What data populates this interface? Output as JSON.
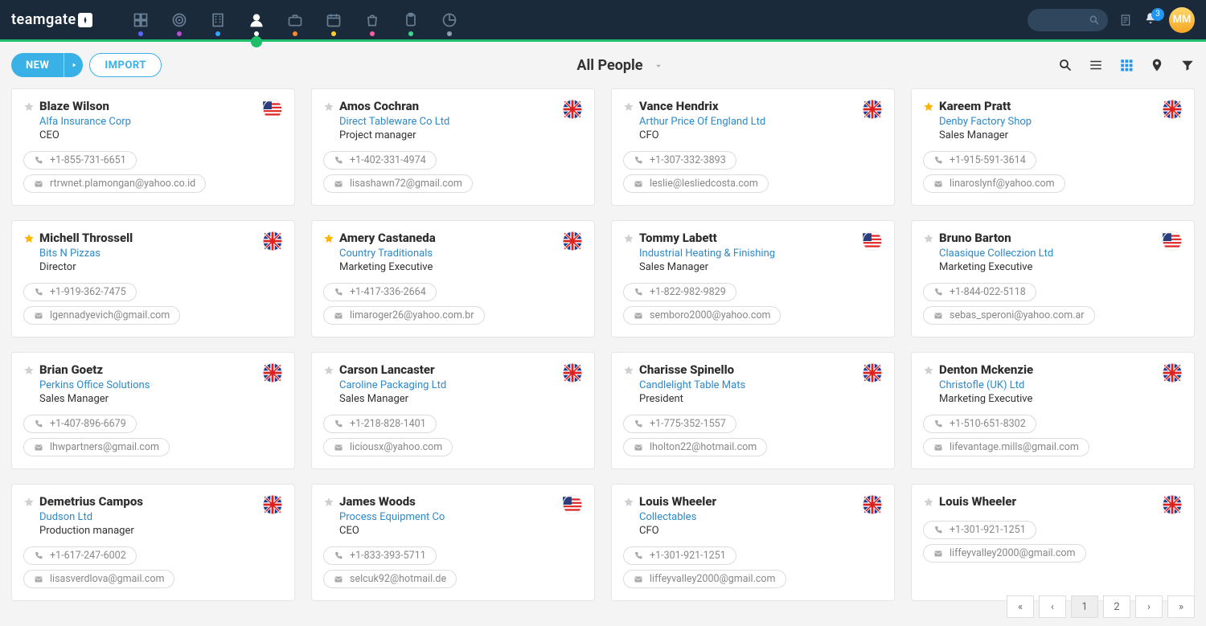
{
  "brand": "teamgate",
  "nav_dots": [
    "#5a66ff",
    "#b94fd8",
    "#2ea6ff",
    "#fff",
    "#ff8a30",
    "#ffcc33",
    "#ff5da1",
    "#39d98a",
    "#8ea0b5"
  ],
  "active_nav_index": 3,
  "notification_count": "3",
  "user_initials": "MM",
  "toolbar": {
    "new": "NEW",
    "import": "IMPORT"
  },
  "page_title": "All People",
  "people": [
    {
      "star": false,
      "name": "Blaze Wilson",
      "company": "Alfa Insurance Corp",
      "role": "CEO",
      "phone": "+1-855-731-6651",
      "email": "rtrwnet.plamongan@yahoo.co.id",
      "flag": "us"
    },
    {
      "star": false,
      "name": "Amos Cochran",
      "company": "Direct Tableware Co Ltd",
      "role": "Project manager",
      "phone": "+1-402-331-4974",
      "email": "lisashawn72@gmail.com",
      "flag": "uk"
    },
    {
      "star": false,
      "name": "Vance Hendrix",
      "company": "Arthur Price Of England Ltd",
      "role": "CFO",
      "phone": "+1-307-332-3893",
      "email": "leslie@lesliedcosta.com",
      "flag": "uk"
    },
    {
      "star": true,
      "name": "Kareem Pratt",
      "company": "Denby Factory Shop",
      "role": "Sales Manager",
      "phone": "+1-915-591-3614",
      "email": "linaroslynf@yahoo.com",
      "flag": "uk"
    },
    {
      "star": true,
      "name": "Michell Throssell",
      "company": "Bits N Pizzas",
      "role": "Director",
      "phone": "+1-919-362-7475",
      "email": "lgennadyevich@gmail.com",
      "flag": "uk"
    },
    {
      "star": true,
      "name": "Amery Castaneda",
      "company": "Country Traditionals",
      "role": "Marketing Executive",
      "phone": "+1-417-336-2664",
      "email": "limaroger26@yahoo.com.br",
      "flag": "uk"
    },
    {
      "star": false,
      "name": "Tommy Labett",
      "company": "Industrial Heating & Finishing",
      "role": "Sales Manager",
      "phone": "+1-822-982-9829",
      "email": "semboro2000@yahoo.com",
      "flag": "us"
    },
    {
      "star": false,
      "name": "Bruno Barton",
      "company": "Claasique Colleczion Ltd",
      "role": "Marketing Executive",
      "phone": "+1-844-022-5118",
      "email": "sebas_speroni@yahoo.com.ar",
      "flag": "us"
    },
    {
      "star": false,
      "name": "Brian Goetz",
      "company": "Perkins Office Solutions",
      "role": "Sales Manager",
      "phone": "+1-407-896-6679",
      "email": "lhwpartners@gmail.com",
      "flag": "uk"
    },
    {
      "star": false,
      "name": "Carson Lancaster",
      "company": "Caroline Packaging Ltd",
      "role": "Sales Manager",
      "phone": "+1-218-828-1401",
      "email": "liciousx@yahoo.com",
      "flag": "uk"
    },
    {
      "star": false,
      "name": "Charisse Spinello",
      "company": "Candlelight Table Mats",
      "role": "President",
      "phone": "+1-775-352-1557",
      "email": "lholton22@hotmail.com",
      "flag": "uk"
    },
    {
      "star": false,
      "name": "Denton Mckenzie",
      "company": "Christofle (UK) Ltd",
      "role": "Marketing Executive",
      "phone": "+1-510-651-8302",
      "email": "lifevantage.mills@gmail.com",
      "flag": "uk"
    },
    {
      "star": false,
      "name": "Demetrius Campos",
      "company": "Dudson Ltd",
      "role": "Production manager",
      "phone": "+1-617-247-6002",
      "email": "lisasverdlova@gmail.com",
      "flag": "uk"
    },
    {
      "star": false,
      "name": "James Woods",
      "company": "Process Equipment Co",
      "role": "CEO",
      "phone": "+1-833-393-5711",
      "email": "selcuk92@hotmail.de",
      "flag": "us"
    },
    {
      "star": false,
      "name": "Louis Wheeler",
      "company": "Collectables",
      "role": "CFO",
      "phone": "+1-301-921-1251",
      "email": "liffeyvalley2000@gmail.com",
      "flag": "uk"
    },
    {
      "star": false,
      "name": "Louis Wheeler",
      "company": "",
      "role": "",
      "phone": "+1-301-921-1251",
      "email": "liffeyvalley2000@gmail.com",
      "flag": "uk"
    }
  ],
  "pagination": {
    "pages": [
      "1",
      "2"
    ],
    "current": 0
  }
}
